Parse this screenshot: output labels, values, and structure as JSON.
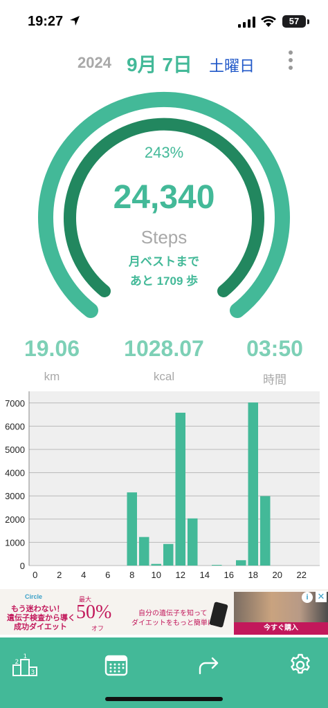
{
  "status_bar": {
    "time": "19:27",
    "battery": "57",
    "icons": [
      "location-arrow-icon",
      "cellular-signal-icon",
      "wifi-icon",
      "battery-icon"
    ]
  },
  "header": {
    "year": "2024",
    "month_day": "9月 7日",
    "weekday": "土曜日",
    "menu_icon": "more-vertical-icon"
  },
  "gauge": {
    "percent_text": "243%",
    "steps_value": "24,340",
    "steps_label": "Steps",
    "best_line1": "月ベストまで",
    "best_line2": "あと 1709 歩",
    "outer_ring_fill": 1.0,
    "inner_ring_fill": 1.0
  },
  "stats": [
    {
      "value": "19.06",
      "unit": "km"
    },
    {
      "value": "1028.07",
      "unit": "kcal"
    },
    {
      "value": "03:50",
      "unit": "時間"
    }
  ],
  "chart_data": {
    "type": "bar",
    "x": [
      0,
      1,
      2,
      3,
      4,
      5,
      6,
      7,
      8,
      9,
      10,
      11,
      12,
      13,
      14,
      15,
      16,
      17,
      18,
      19,
      20,
      21,
      22,
      23
    ],
    "values": [
      0,
      0,
      0,
      0,
      0,
      0,
      0,
      0,
      3150,
      1230,
      70,
      930,
      6580,
      2030,
      0,
      30,
      0,
      230,
      7020,
      2990,
      0,
      0,
      0,
      0
    ],
    "x_ticks": [
      "0",
      "2",
      "4",
      "6",
      "8",
      "10",
      "12",
      "14",
      "16",
      "18",
      "20",
      "22"
    ],
    "y_ticks": [
      "0",
      "1000",
      "2000",
      "3000",
      "4000",
      "5000",
      "6000",
      "7000"
    ],
    "ylim": [
      0,
      7500
    ],
    "grid": true,
    "title": "",
    "xlabel": "",
    "ylabel": ""
  },
  "ad": {
    "logo": "Circle",
    "line1": "もう迷わない！",
    "line2": "遺伝子検査から導く",
    "line3": "成功ダイエット",
    "max": "最大",
    "percent": "50%",
    "off": "オフ",
    "text1": "自分の遺伝子を知って",
    "text2": "ダイエットをもっと簡単に！",
    "cta": "今すぐ購入",
    "info": "i",
    "close": "✕"
  },
  "tabbar": {
    "tabs": [
      "ranking-podium-icon",
      "calendar-icon",
      "share-arrow-icon",
      "settings-gear-icon"
    ]
  },
  "colors": {
    "accent": "#43b998",
    "accent_dark": "#22875f",
    "accent_light": "#7dd0b6",
    "weekday_blue": "#1f57c8",
    "muted_gray": "#a8a8a8",
    "chart_bg": "#efefef",
    "ad_pink": "#c2185b"
  }
}
